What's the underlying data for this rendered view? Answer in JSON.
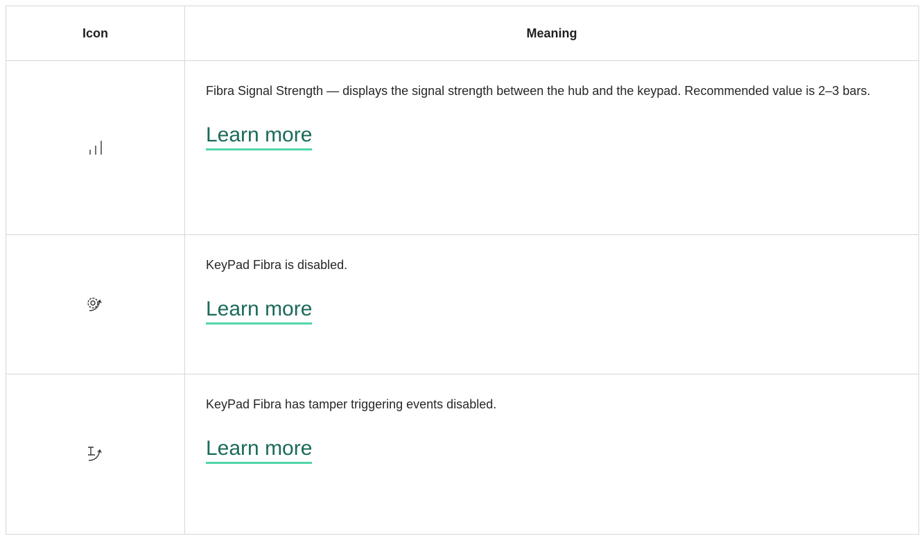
{
  "table": {
    "headers": {
      "icon": "Icon",
      "meaning": "Meaning"
    },
    "rows": [
      {
        "icon": "signal-strength-icon",
        "description": "Fibra Signal Strength — displays the signal strength between the hub and the keypad. Recommended value is 2–3 bars.",
        "link": "Learn more"
      },
      {
        "icon": "device-disabled-gear-icon",
        "description": "KeyPad Fibra is disabled.",
        "link": "Learn more"
      },
      {
        "icon": "tamper-disabled-icon",
        "description": "KeyPad Fibra has tamper triggering events disabled.",
        "link": "Learn more"
      }
    ]
  },
  "colors": {
    "link_underline": "#4fd6a8",
    "link_text": "#1a6a5a",
    "border": "#d6d6d6"
  }
}
